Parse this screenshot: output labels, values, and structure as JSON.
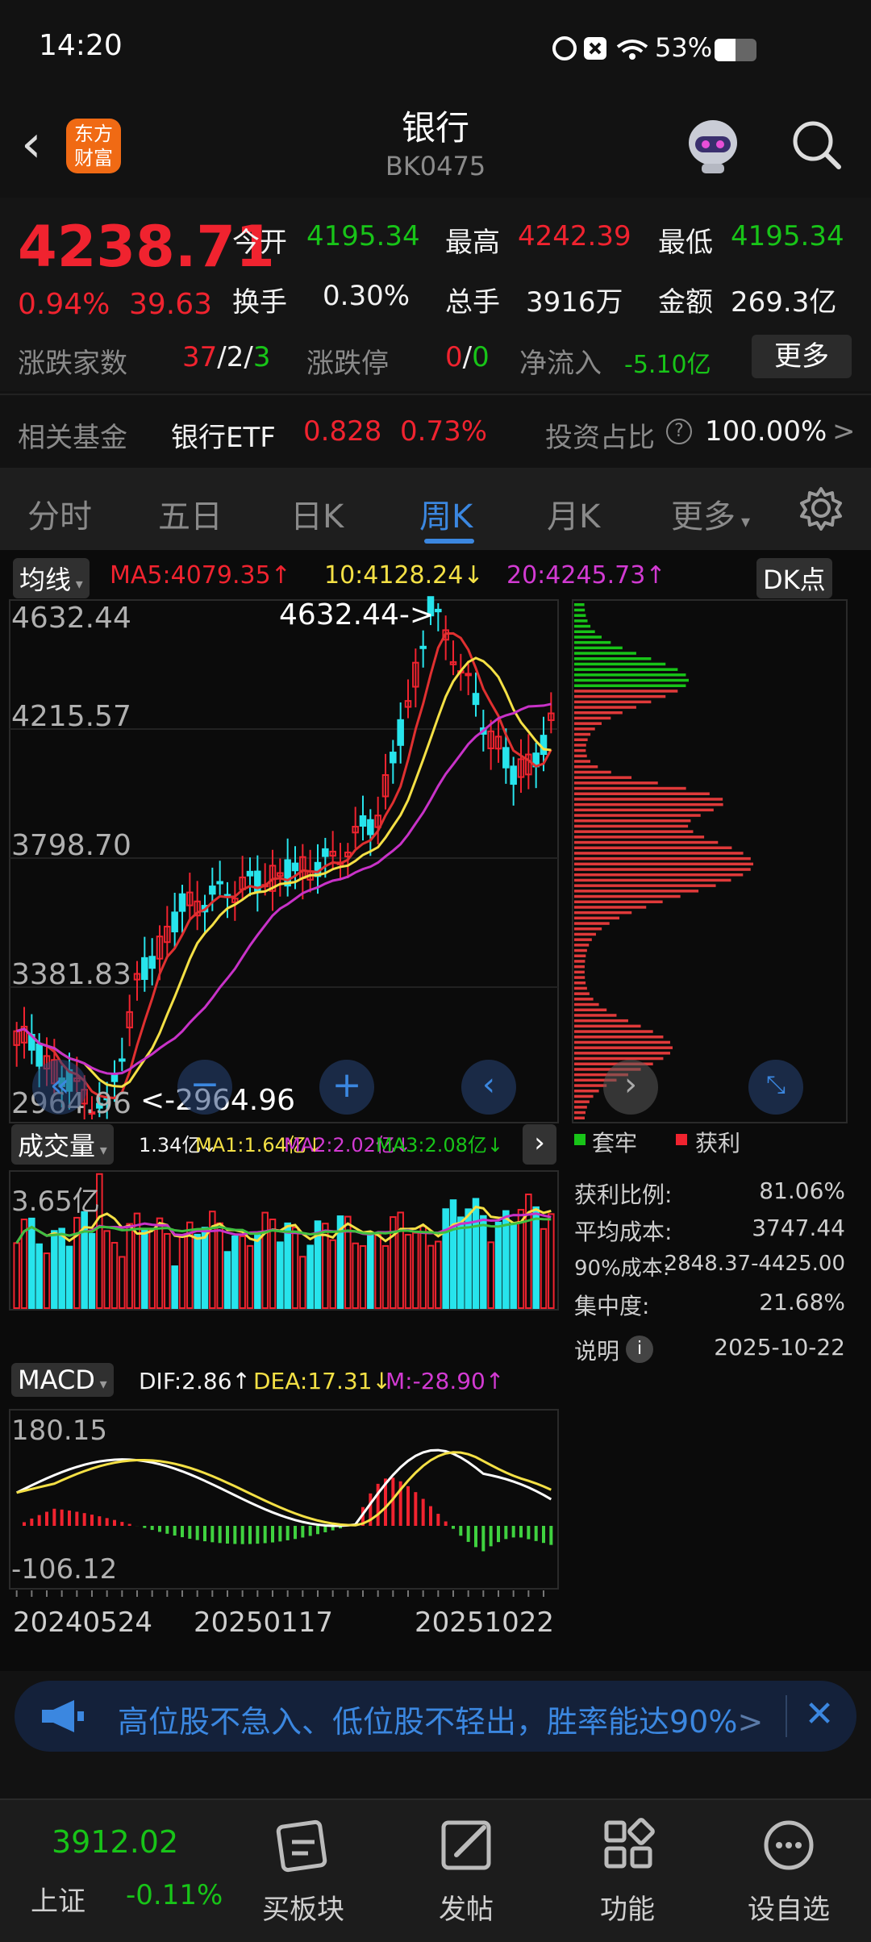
{
  "status": {
    "time": "14:20",
    "battery": "53%"
  },
  "header": {
    "logo": "东方财富",
    "title": "银行",
    "code": "BK0475"
  },
  "quote": {
    "price": "4238.71",
    "pct": "0.94%",
    "chg": "39.63",
    "open_label": "今开",
    "open": "4195.34",
    "high_label": "最高",
    "high": "4242.39",
    "low_label": "最低",
    "low": "4195.34",
    "turnover_label": "换手",
    "turnover": "0.30%",
    "volume_label": "总手",
    "volume": "3916万",
    "amount_label": "金额",
    "amount": "269.3亿",
    "breadth_label": "涨跌家数",
    "breadth_up": "37",
    "breadth_flat": "2",
    "breadth_down": "3",
    "sep": "/",
    "limit_label": "涨跌停",
    "limit_up": "0",
    "limit_down": "0",
    "netflow_label": "净流入",
    "netflow": "-5.10亿",
    "more": "更多"
  },
  "fund": {
    "label": "相关基金",
    "name": "银行ETF",
    "price": "0.828",
    "pct": "0.73%",
    "ratio_label": "投资占比",
    "ratio": "100.00%",
    "arrow": ">"
  },
  "tabs": [
    "分时",
    "五日",
    "日K",
    "周K",
    "月K",
    "更多"
  ],
  "chart": {
    "ma_btn": "均线",
    "ma5": "MA5:4079.35↑",
    "ma10": "10:4128.24↓",
    "ma20": "20:4245.73↑",
    "dk": "DK点",
    "y_labels": [
      "4632.44",
      "4215.57",
      "3798.70",
      "3381.83",
      "2964.96"
    ],
    "high_tag": "4632.44->",
    "low_tag": "<-2964.96",
    "vol_btn": "成交量",
    "vol_val": "1.34亿↓",
    "vol_ma1": "MA1:1.64亿↓",
    "vol_ma2": "MA2:2.02亿↓",
    "vol_ma3": "MA3:2.08亿↓",
    "vol_max": "3.65亿",
    "macd_btn": "MACD",
    "dif": "DIF:2.86↑",
    "dea": "DEA:17.31↓",
    "m": "M:-28.90↑",
    "macd_max": "180.15",
    "macd_min": "-106.12",
    "x_labels": [
      "20240524",
      "20250117",
      "20251022"
    ]
  },
  "chips": {
    "legend_trap": "套牢",
    "legend_profit": "获利",
    "profit_label": "获利比例:",
    "profit": "81.06%",
    "avg_label": "平均成本:",
    "avg": "3747.44",
    "c90_label": "90%成本:",
    "c90": "2848.37-4425.00",
    "conc_label": "集中度:",
    "conc": "21.68%",
    "note_label": "说明",
    "date": "2025-10-22"
  },
  "banner": {
    "text": "高位股不急入、低位股不轻出，胜率能达90%",
    "arrow": ">"
  },
  "nav": {
    "index_price": "3912.02",
    "index_name": "上证",
    "index_pct": "-0.11%",
    "items": [
      "买板块",
      "发帖",
      "功能",
      "设自选"
    ]
  },
  "colors": {
    "up": "#f0232f",
    "down": "#18c418",
    "accent": "#3b87e0",
    "cyan": "#27e4ec"
  }
}
